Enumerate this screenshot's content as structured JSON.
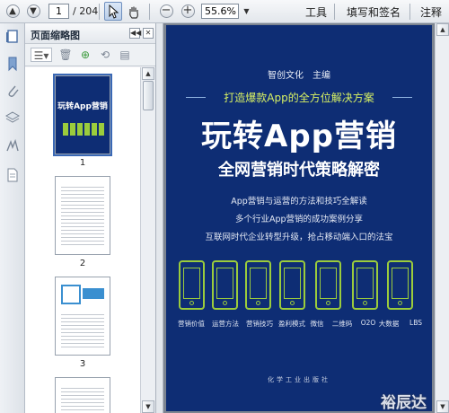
{
  "toolbar": {
    "page_current": "1",
    "page_total": "/ 204",
    "zoom": "55.6%",
    "menu": [
      "工具",
      "填写和签名",
      "注释"
    ]
  },
  "panel": {
    "title": "页面缩略图",
    "thumbnails": [
      {
        "number": "1"
      },
      {
        "number": "2"
      },
      {
        "number": "3"
      }
    ]
  },
  "cover": {
    "author": "智创文化　主编",
    "slogan": "打造爆款App的全方位解决方案",
    "title": "玩转App营销",
    "subtitle": "全网营销时代策略解密",
    "points": [
      "App营销与运营的方法和技巧全解读",
      "多个行业App营销的成功案例分享",
      "互联网时代企业转型升级，抢占移动端入口的法宝"
    ],
    "icon_labels": [
      "营销价值",
      "运营方法",
      "营销技巧",
      "盈利模式",
      "微信",
      "二维码",
      "O2O",
      "大数据",
      "LBS"
    ],
    "publisher": "化学工业出版社",
    "accent_color": "#9bcc3c",
    "background_color": "#0e2d74"
  },
  "watermark": "裕辰达"
}
